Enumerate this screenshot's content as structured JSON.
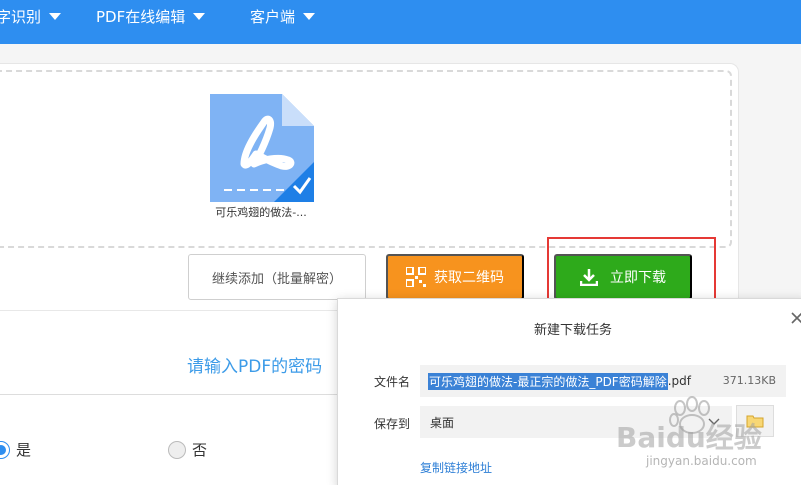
{
  "nav": {
    "items": [
      {
        "label": "字识别"
      },
      {
        "label": "PDF在线编辑"
      },
      {
        "label": "客户端"
      }
    ]
  },
  "upload": {
    "file_name": "可乐鸡翅的做法-...",
    "continue_button": "继续添加（批量解密）",
    "qr_button": "获取二维码",
    "download_button": "立即下载"
  },
  "password": {
    "title": "请输入PDF的密码",
    "options": [
      {
        "label": "是",
        "selected": true
      },
      {
        "label": "否",
        "selected": false
      }
    ]
  },
  "dialog": {
    "title": "新建下载任务",
    "file_label": "文件名",
    "file_name_selected": "可乐鸡翅的做法-最正宗的做法_PDF密码解除",
    "file_ext": ".pdf",
    "file_size": "371.13KB",
    "save_label": "保存到",
    "save_location": "桌面",
    "copy_link": "复制链接地址"
  },
  "watermark": {
    "brand": "Baidu经验",
    "url": "jingyan.baidu.com"
  },
  "colors": {
    "nav_blue": "#2e8ef0",
    "qr_orange": "#f7931e",
    "download_green": "#2eaa1b",
    "highlight_red": "#e53935"
  },
  "icons": [
    "caret-down-icon",
    "pdf-file-icon",
    "check-icon",
    "qr-code-icon",
    "download-icon",
    "close-icon",
    "chevron-down-icon",
    "folder-icon",
    "baidu-paw-icon"
  ]
}
